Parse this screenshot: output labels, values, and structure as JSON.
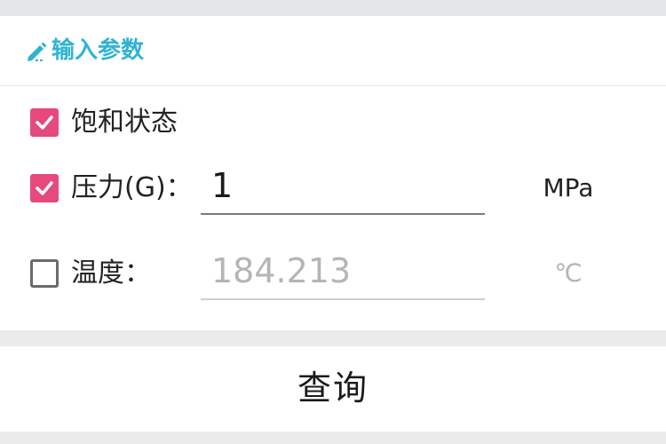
{
  "header": {
    "title": "输入参数",
    "icon": "pencil-icon",
    "title_color": "#2fb3d3"
  },
  "rows": [
    {
      "label": "饱和状态",
      "checked": true
    },
    {
      "label": "压力(G)：",
      "checked": true,
      "value": "1",
      "unit": "MPa"
    },
    {
      "label": "温度：",
      "checked": false,
      "value": "184.213",
      "unit": "℃"
    }
  ],
  "checkbox_color": "#e6497c",
  "query_button": {
    "label": "查询"
  }
}
